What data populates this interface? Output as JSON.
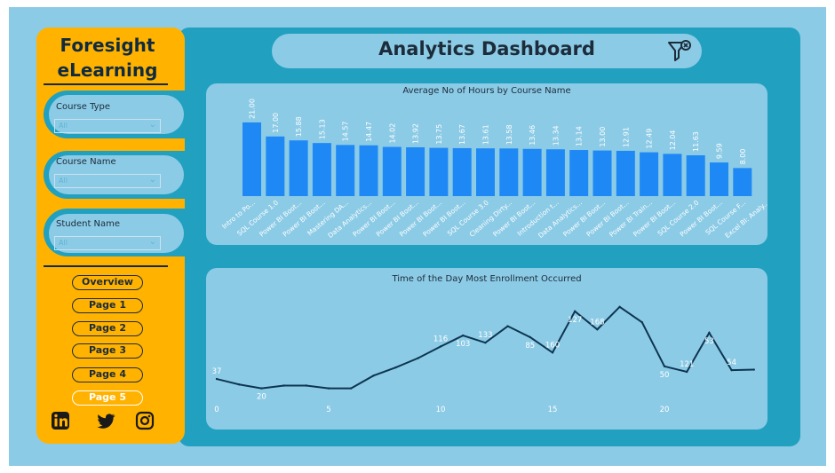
{
  "brand": {
    "line1": "Foresight",
    "line2": "eLearning"
  },
  "filters": [
    {
      "label": "Course Type",
      "value": "All"
    },
    {
      "label": "Course Name",
      "value": "All"
    },
    {
      "label": "Student Name",
      "value": "All"
    }
  ],
  "nav": [
    {
      "label": "Overview",
      "active": false
    },
    {
      "label": "Page 1",
      "active": false
    },
    {
      "label": "Page 2",
      "active": false
    },
    {
      "label": "Page 3",
      "active": false
    },
    {
      "label": "Page 4",
      "active": false
    },
    {
      "label": "Page 5",
      "active": true
    }
  ],
  "social_icons": [
    "linkedin-icon",
    "twitter-icon",
    "instagram-icon"
  ],
  "header": {
    "title": "Analytics Dashboard",
    "filter_icon": "clear-filter-icon"
  },
  "colors": {
    "sidebar": "#ffb200",
    "main": "#21a0c0",
    "panel": "#8ccbe6",
    "bar": "#1e88f5",
    "line": "#0d3550",
    "text": "#1c2c3a"
  },
  "chart_data": [
    {
      "type": "bar",
      "title": "Average No of Hours by Course Name",
      "categories": [
        "Intro to Po...",
        "SQL Course 1.0",
        "Power BI Boot...",
        "Power BI Boot...",
        "Mastering DA...",
        "Data Analytics...",
        "Power BI Boot...",
        "Power BI Boot...",
        "Power BI Boot...",
        "Power BI Boot...",
        "SQL Course 3.0",
        "Cleaning Dirty...",
        "Power BI Boot...",
        "Introduction t...",
        "Data Analytics...",
        "Power BI Boot...",
        "Power BI Boot...",
        "Power BI Train...",
        "Power BI Boot...",
        "SQL Course 2.0",
        "Power BI Boot...",
        "SQL Course F...",
        "Excel BI: Analy..."
      ],
      "values": [
        21.0,
        17.0,
        15.88,
        15.13,
        14.57,
        14.47,
        14.02,
        13.92,
        13.75,
        13.67,
        13.61,
        13.58,
        13.46,
        13.34,
        13.14,
        13.0,
        12.91,
        12.49,
        12.04,
        11.63,
        9.59,
        8.0
      ],
      "labels": [
        "21.00",
        "17.00",
        "15.88",
        "15.13",
        "14.57",
        "14.47",
        "14.02",
        "13.92",
        "13.75",
        "13.67",
        "13.61",
        "13.58",
        "13.46",
        "13.34",
        "13.14",
        "13.00",
        "12.91",
        "12.49",
        "12.04",
        "11.63",
        "9.59",
        "8.00"
      ],
      "ylim": [
        0,
        22
      ]
    },
    {
      "type": "line",
      "title": "Time of the Day Most Enrollment Occurred",
      "x": [
        0,
        1,
        2,
        3,
        4,
        5,
        6,
        7,
        8,
        9,
        10,
        11,
        12,
        13,
        14,
        15,
        16,
        17,
        18,
        19,
        20,
        21,
        22,
        23
      ],
      "values": [
        37,
        27,
        20,
        25,
        25,
        20,
        20,
        43,
        58,
        75,
        96,
        116,
        103,
        133,
        113,
        85,
        160,
        127,
        168,
        140,
        60,
        50,
        121,
        53,
        54
      ],
      "point_labels": [
        {
          "index": 0,
          "text": "37"
        },
        {
          "index": 2,
          "text": "20"
        },
        {
          "index": 10,
          "text": "116"
        },
        {
          "index": 11,
          "text": "103"
        },
        {
          "index": 12,
          "text": "133"
        },
        {
          "index": 14,
          "text": "85"
        },
        {
          "index": 15,
          "text": "160"
        },
        {
          "index": 16,
          "text": "127"
        },
        {
          "index": 17,
          "text": "168"
        },
        {
          "index": 20,
          "text": "50"
        },
        {
          "index": 21,
          "text": "121"
        },
        {
          "index": 22,
          "text": "53"
        },
        {
          "index": 23,
          "text": "54"
        }
      ],
      "xticks": [
        "0",
        "5",
        "10",
        "15",
        "20"
      ],
      "ylim": [
        0,
        180
      ]
    }
  ]
}
